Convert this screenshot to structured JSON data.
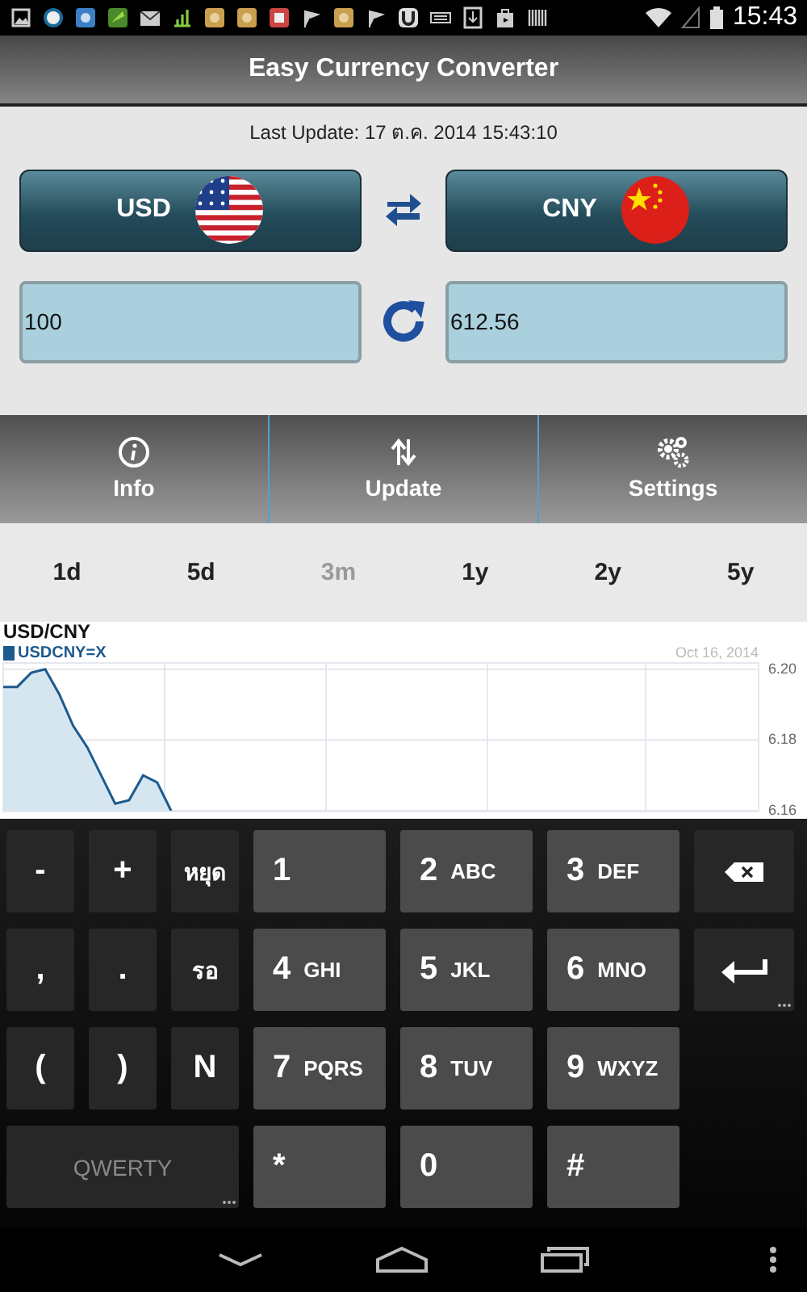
{
  "status_bar": {
    "time": "15:43"
  },
  "title": "Easy Currency Converter",
  "last_update": "Last Update: 17 ต.ค. 2014 15:43:10",
  "from_currency": {
    "code": "USD"
  },
  "to_currency": {
    "code": "CNY"
  },
  "amount": {
    "value": "100"
  },
  "result": {
    "value": "612.56"
  },
  "toolbar": [
    {
      "label": "Info"
    },
    {
      "label": "Update"
    },
    {
      "label": "Settings"
    }
  ],
  "periods": [
    {
      "label": "1d",
      "selected": false
    },
    {
      "label": "5d",
      "selected": false
    },
    {
      "label": "3m",
      "selected": true
    },
    {
      "label": "1y",
      "selected": false
    },
    {
      "label": "2y",
      "selected": false
    },
    {
      "label": "5y",
      "selected": false
    }
  ],
  "chart": {
    "title": "USD/CNY",
    "date": "Oct 16, 2014",
    "chart_data": {
      "type": "area",
      "grid": true,
      "categories": [
        null,
        null,
        null,
        null,
        null,
        null,
        null,
        null,
        null,
        null,
        null,
        null,
        null,
        null,
        null,
        null,
        null,
        null,
        null,
        null,
        null,
        null,
        null,
        null,
        null,
        null,
        null,
        null,
        null,
        null,
        null,
        null,
        null,
        null,
        null,
        null,
        null,
        null,
        null,
        null,
        null,
        null,
        null,
        null,
        null,
        null,
        null,
        null,
        null,
        null,
        null,
        null,
        null,
        null,
        null
      ],
      "ylim": [
        6.16,
        6.202
      ],
      "yticks": [
        {
          "value": 6.2,
          "label": "6.20"
        },
        {
          "value": 6.18,
          "label": "6.18"
        },
        {
          "value": 6.16,
          "label": "6.16"
        }
      ],
      "series": [
        {
          "name": "USDCNY=X",
          "color": "#1d5a8e",
          "values": [
            6.195,
            6.195,
            6.199,
            6.2,
            6.193,
            6.184,
            6.178,
            6.17,
            6.162,
            6.163,
            6.17,
            6.168,
            6.16,
            null,
            null,
            null,
            null,
            null,
            null,
            null,
            null,
            null,
            null,
            null,
            null,
            null,
            null,
            null,
            null,
            null,
            null,
            null,
            null,
            null,
            null,
            null,
            null,
            null,
            null,
            null,
            null,
            null,
            null,
            null,
            null,
            null,
            null,
            null,
            null,
            null,
            null,
            null,
            null,
            null,
            null
          ]
        }
      ]
    }
  },
  "keyboard": [
    [
      {
        "kind": "symbol",
        "label": "-"
      },
      {
        "kind": "symbol",
        "label": "+"
      },
      {
        "kind": "symbol",
        "label": "หยุด"
      },
      {
        "kind": "digit",
        "digit": "1"
      },
      {
        "kind": "digit",
        "digit": "2",
        "letters": "ABC"
      },
      {
        "kind": "digit",
        "digit": "3",
        "letters": "DEF"
      },
      {
        "kind": "backspace"
      }
    ],
    [
      {
        "kind": "symbol",
        "label": ","
      },
      {
        "kind": "symbol",
        "label": "."
      },
      {
        "kind": "symbol",
        "label": "รอ"
      },
      {
        "kind": "digit",
        "digit": "4",
        "letters": "GHI"
      },
      {
        "kind": "digit",
        "digit": "5",
        "letters": "JKL"
      },
      {
        "kind": "digit",
        "digit": "6",
        "letters": "MNO"
      },
      {
        "kind": "enter",
        "more": true
      }
    ],
    [
      {
        "kind": "symbol",
        "label": "("
      },
      {
        "kind": "symbol",
        "label": ")"
      },
      {
        "kind": "symbol",
        "label": "N"
      },
      {
        "kind": "digit",
        "digit": "7",
        "letters": "PQRS"
      },
      {
        "kind": "digit",
        "digit": "8",
        "letters": "TUV"
      },
      {
        "kind": "digit",
        "digit": "9",
        "letters": "WXYZ"
      }
    ],
    [
      {
        "kind": "mode",
        "label": "QWERTY",
        "more": true
      },
      {
        "kind": "digit",
        "digit": "*"
      },
      {
        "kind": "digit",
        "digit": "0"
      },
      {
        "kind": "digit",
        "digit": "#"
      }
    ]
  ]
}
